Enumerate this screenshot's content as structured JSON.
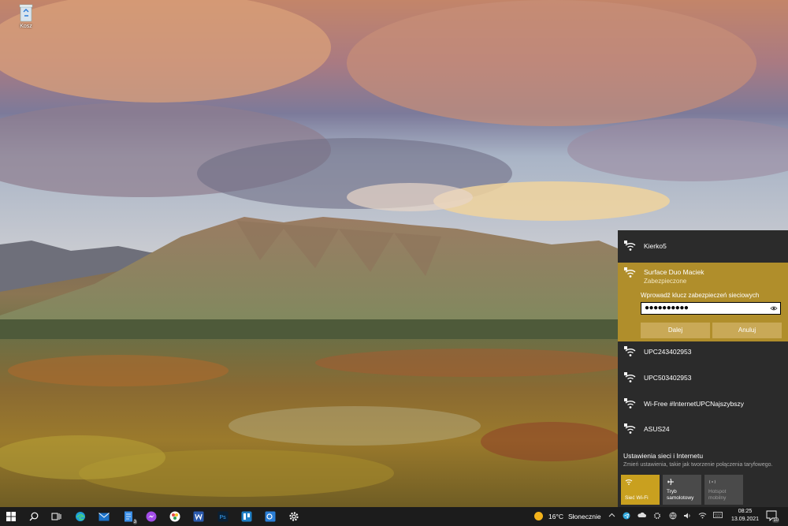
{
  "desktop": {
    "recycle_bin_label": "Kosz"
  },
  "flyout": {
    "networks_top": [
      {
        "name": "Kierko5"
      }
    ],
    "expanded": {
      "name": "Surface Duo Maciek",
      "status": "Zabezpieczone",
      "prompt": "Wprowadź klucz zabezpieczeń sieciowych",
      "password_masked": "●●●●●●●●●●",
      "next_label": "Dalej",
      "cancel_label": "Anuluj"
    },
    "networks": [
      {
        "name": "UPC243402953"
      },
      {
        "name": "UPC503402953"
      },
      {
        "name": "Wi-Free #InternetUPCNajszybszy"
      },
      {
        "name": "ASUS24"
      }
    ],
    "settings_title": "Ustawienia sieci i Internetu",
    "settings_desc": "Zmień ustawienia, takie jak tworzenie połączenia taryfowego.",
    "tiles": [
      {
        "label": "Sieć Wi-Fi",
        "state": "on",
        "icon": "wifi-icon"
      },
      {
        "label": "Tryb samolotowy",
        "state": "neutral",
        "icon": "airplane-icon"
      },
      {
        "label": "Hotspot mobilny",
        "state": "off",
        "icon": "hotspot-icon"
      }
    ]
  },
  "taskbar": {
    "weather_temp": "16°C",
    "weather_desc": "Słonecznie",
    "time": "08:25",
    "date": "13.09.2021",
    "notification_count": "10",
    "store_badge": "3",
    "accent_color": "#c9a01f"
  }
}
